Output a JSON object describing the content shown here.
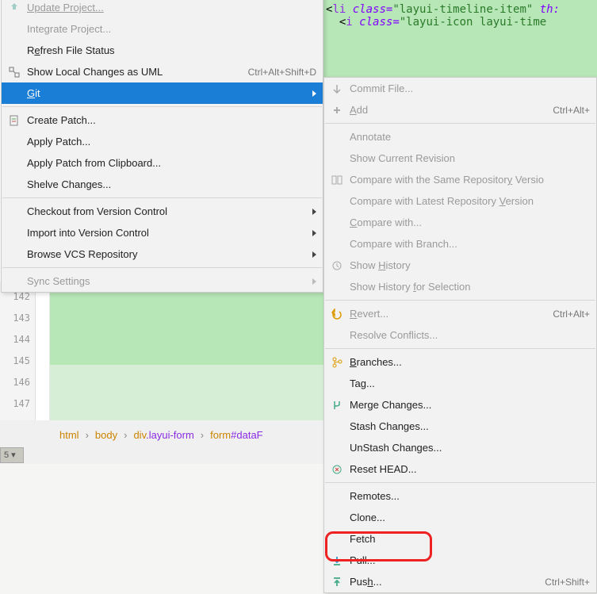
{
  "editor": {
    "gutter_lines": [
      "142",
      "143",
      "144",
      "145",
      "146",
      "147"
    ],
    "code_line1_tag": "li",
    "code_line1_attr": "class=",
    "code_line1_val": "\"layui-timeline-item\"",
    "code_line1_extra": " th:",
    "code_line2_tag": "i",
    "code_line2_attr": "class=",
    "code_line2_val": "\"layui-icon layui-time"
  },
  "breadcrumb": {
    "p0": "html",
    "p1": "body",
    "p2": "div",
    "p2_cls": ".layui-form",
    "p3": "form",
    "p3_id": "#dataF"
  },
  "tabbar_label": "5 ▾",
  "menu1": {
    "update_project": "Update Project...",
    "integrate_project": "Integrate Project...",
    "refresh": "Refresh File Status",
    "show_local": "Show Local Changes as UML",
    "show_local_sc": "Ctrl+Alt+Shift+D",
    "git": "Git",
    "create_patch": "Create Patch...",
    "apply_patch": "Apply Patch...",
    "apply_clip": "Apply Patch from Clipboard...",
    "shelve": "Shelve Changes...",
    "checkout": "Checkout from Version Control",
    "import_vc": "Import into Version Control",
    "browse_vcs": "Browse VCS Repository",
    "sync": "Sync Settings"
  },
  "menu2": {
    "commit": "Commit File...",
    "add": "Add",
    "add_sc": "Ctrl+Alt+",
    "annotate": "Annotate",
    "show_cur": "Show Current Revision",
    "cmp_same": "Compare with the Same Repository Versio",
    "cmp_latest": "Compare with Latest Repository Version",
    "cmp_with": "Compare with...",
    "cmp_branch": "Compare with Branch...",
    "history": "Show History",
    "history_sel": "Show History for Selection",
    "revert": "Revert...",
    "revert_sc": "Ctrl+Alt+",
    "resolve": "Resolve Conflicts...",
    "branches": "Branches...",
    "tag": "Tag...",
    "merge": "Merge Changes...",
    "stash": "Stash Changes...",
    "unstash": "UnStash Changes...",
    "reset": "Reset HEAD...",
    "remotes": "Remotes...",
    "clone": "Clone...",
    "fetch": "Fetch",
    "pull": "Pull...",
    "push": "Push...",
    "push_sc": "Ctrl+Shift+"
  }
}
